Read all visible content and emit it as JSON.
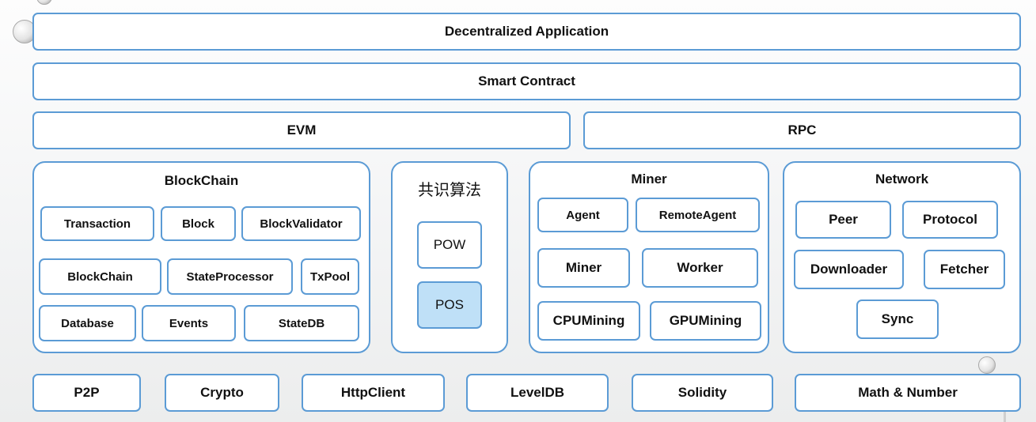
{
  "layers": {
    "dapp": "Decentralized Application",
    "smart_contract": "Smart Contract",
    "evm": "EVM",
    "rpc": "RPC"
  },
  "blockchain": {
    "title": "BlockChain",
    "items": [
      "Transaction",
      "Block",
      "BlockValidator",
      "BlockChain",
      "StateProcessor",
      "TxPool",
      "Database",
      "Events",
      "StateDB"
    ]
  },
  "consensus": {
    "title": "共识算法",
    "items": [
      "POW",
      "POS"
    ]
  },
  "miner": {
    "title": "Miner",
    "items": [
      "Agent",
      "RemoteAgent",
      "Miner",
      "Worker",
      "CPUMining",
      "GPUMining"
    ]
  },
  "network": {
    "title": "Network",
    "items": [
      "Peer",
      "Protocol",
      "Downloader",
      "Fetcher",
      "Sync"
    ]
  },
  "bottom": [
    "P2P",
    "Crypto",
    "HttpClient",
    "LevelDB",
    "Solidity",
    "Math & Number"
  ]
}
